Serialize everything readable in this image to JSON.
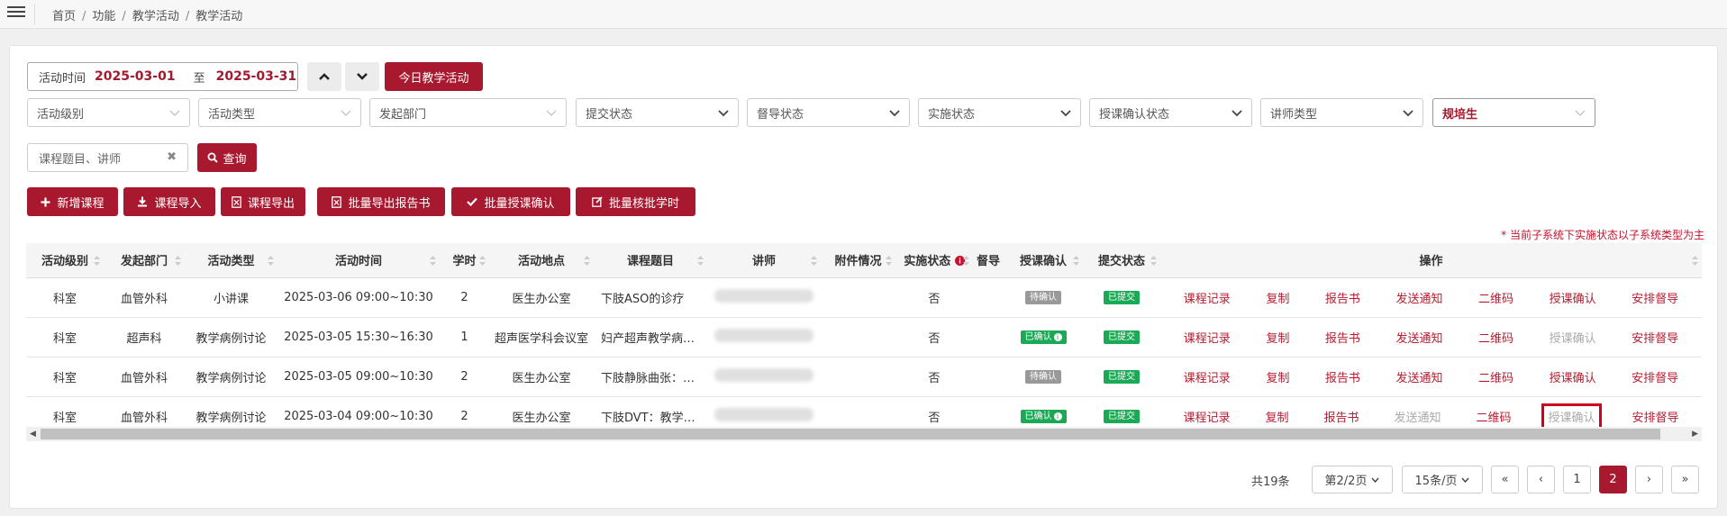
{
  "breadcrumb": [
    "首页",
    "功能",
    "教学活动",
    "教学活动"
  ],
  "filters": {
    "date_label": "活动时间",
    "date_start": "2025-03-01",
    "date_to": "至",
    "date_end": "2025-03-31",
    "today_button": "今日教学活动",
    "selects": [
      "活动级别",
      "活动类型",
      "发起部门",
      "提交状态",
      "督导状态",
      "实施状态",
      "授课确认状态",
      "讲师类型"
    ],
    "student_type": "规培生",
    "keyword_placeholder": "课程题目、讲师",
    "query_button": "查询"
  },
  "actions": [
    "新增课程",
    "课程导入",
    "课程导出",
    "批量导出报告书",
    "批量授课确认",
    "批量核批学时"
  ],
  "notice": "* 当前子系统下实施状态以子系统类型为主",
  "table": {
    "columns": [
      "活动级别",
      "发起部门",
      "活动类型",
      "活动时间",
      "学时",
      "活动地点",
      "课程题目",
      "讲师",
      "附件情况",
      "实施状态",
      "督导",
      "授课确认",
      "提交状态",
      "操作"
    ],
    "rows": [
      {
        "level": "科室",
        "dept": "血管外科",
        "type": "小讲课",
        "time": "2025-03-06  09:00~10:30",
        "hours": "2",
        "place": "医生办公室",
        "topic": "下肢ASO的诊疗",
        "status": "否",
        "confirm": "待确认",
        "submit": "已提交"
      },
      {
        "level": "科室",
        "dept": "超声科",
        "type": "教学病例讨论",
        "time": "2025-03-05  15:30~16:30",
        "hours": "1",
        "place": "超声医学科会议室",
        "topic": "妇产超声教学病…",
        "status": "否",
        "confirm": "已确认",
        "submit": "已提交"
      },
      {
        "level": "科室",
        "dept": "血管外科",
        "type": "教学病例讨论",
        "time": "2025-03-05  09:00~10:30",
        "hours": "2",
        "place": "医生办公室",
        "topic": "下肢静脉曲张：…",
        "status": "否",
        "confirm": "待确认",
        "submit": "已提交"
      },
      {
        "level": "科室",
        "dept": "血管外科",
        "type": "教学病例讨论",
        "time": "2025-03-04  09:00~10:30",
        "hours": "2",
        "place": "医生办公室",
        "topic": "下肢DVT：教学…",
        "status": "否",
        "confirm": "已确认",
        "submit": "已提交"
      }
    ],
    "ops": [
      "课程记录",
      "复制",
      "报告书",
      "发送通知",
      "二维码",
      "授课确认",
      "安排督导"
    ]
  },
  "pagination": {
    "total": "共19条",
    "page_select": "第2/2页",
    "size_select": "15条/页",
    "first": "«",
    "prev": "‹",
    "pages": [
      "1",
      "2"
    ],
    "next": "›",
    "last": "»"
  },
  "colors": {
    "brand": "#a8192f",
    "green": "#1aaa55",
    "grey": "#999999"
  }
}
